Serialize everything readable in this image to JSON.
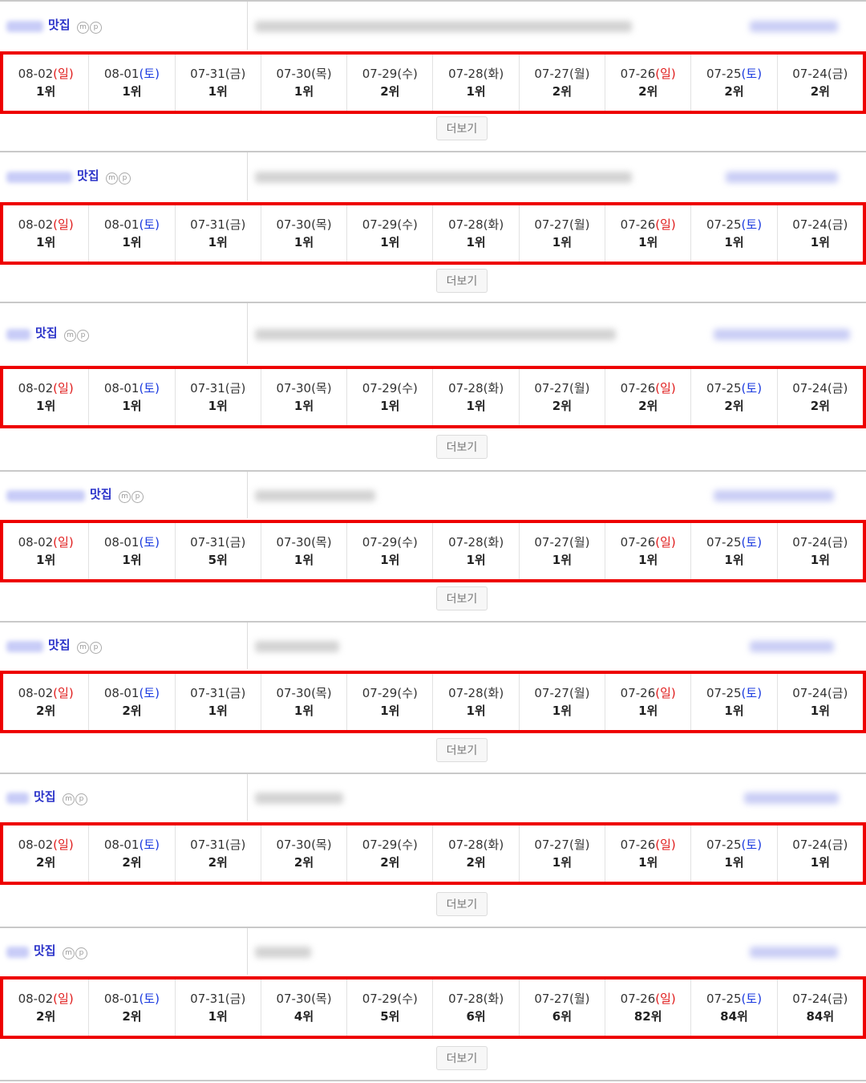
{
  "keyword_suffix": "맛집",
  "mp_icons": [
    "m",
    "p"
  ],
  "more_label": "더보기",
  "dates": [
    {
      "date": "08-02",
      "weekday": "일",
      "type": "sun"
    },
    {
      "date": "08-01",
      "weekday": "토",
      "type": "sat"
    },
    {
      "date": "07-31",
      "weekday": "금",
      "type": "weekday"
    },
    {
      "date": "07-30",
      "weekday": "목",
      "type": "weekday"
    },
    {
      "date": "07-29",
      "weekday": "수",
      "type": "weekday"
    },
    {
      "date": "07-28",
      "weekday": "화",
      "type": "weekday"
    },
    {
      "date": "07-27",
      "weekday": "월",
      "type": "weekday"
    },
    {
      "date": "07-26",
      "weekday": "일",
      "type": "sun"
    },
    {
      "date": "07-25",
      "weekday": "토",
      "type": "sat"
    },
    {
      "date": "07-24",
      "weekday": "금",
      "type": "weekday"
    }
  ],
  "colors": {
    "sunday": "#e01c1c",
    "saturday": "#1a3adf",
    "highlight_border": "#ee0000",
    "keyword": "#2a32c9"
  },
  "keywords": [
    {
      "ranks": [
        "1위",
        "1위",
        "1위",
        "1위",
        "2위",
        "1위",
        "2위",
        "2위",
        "2위",
        "2위"
      ]
    },
    {
      "ranks": [
        "1위",
        "1위",
        "1위",
        "1위",
        "1위",
        "1위",
        "1위",
        "1위",
        "1위",
        "1위"
      ]
    },
    {
      "ranks": [
        "1위",
        "1위",
        "1위",
        "1위",
        "1위",
        "1위",
        "2위",
        "2위",
        "2위",
        "2위"
      ]
    },
    {
      "ranks": [
        "1위",
        "1위",
        "5위",
        "1위",
        "1위",
        "1위",
        "1위",
        "1위",
        "1위",
        "1위"
      ]
    },
    {
      "ranks": [
        "2위",
        "2위",
        "1위",
        "1위",
        "1위",
        "1위",
        "1위",
        "1위",
        "1위",
        "1위"
      ]
    },
    {
      "ranks": [
        "2위",
        "2위",
        "2위",
        "2위",
        "2위",
        "2위",
        "1위",
        "1위",
        "1위",
        "1위"
      ]
    },
    {
      "ranks": [
        "2위",
        "2위",
        "1위",
        "4위",
        "5위",
        "6위",
        "6위",
        "82위",
        "84위",
        "84위"
      ]
    }
  ]
}
